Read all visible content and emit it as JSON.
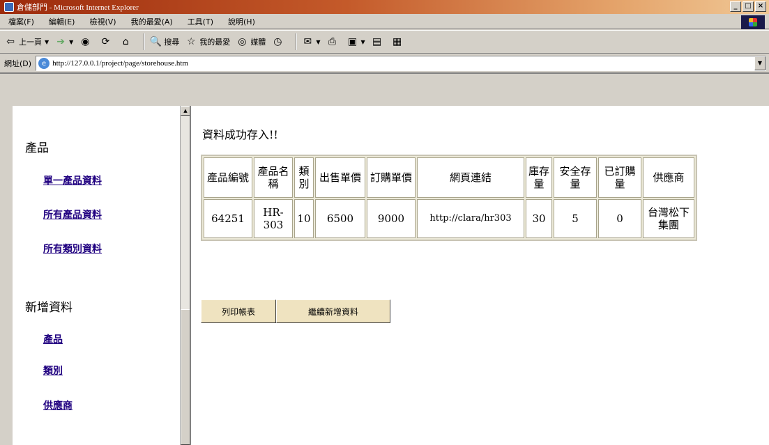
{
  "window": {
    "title": "倉儲部門 - Microsoft Internet Explorer",
    "min": "_",
    "max": "□",
    "close": "×"
  },
  "menu": [
    "檔案(F)",
    "編輯(E)",
    "檢視(V)",
    "我的最愛(A)",
    "工具(T)",
    "說明(H)"
  ],
  "toolbar": {
    "back": "上一頁",
    "search": "搜尋",
    "favorites": "我的最愛",
    "media": "媒體"
  },
  "address": {
    "label": "網址(D)",
    "value": "http://127.0.0.1/project/page/storehouse.htm"
  },
  "nav": {
    "products_title": "產品",
    "product_links": [
      "單一產品資料",
      "所有產品資料",
      "所有類別資料"
    ],
    "add_title": "新增資料",
    "add_links": [
      "產品",
      "類別",
      "供應商"
    ]
  },
  "content": {
    "status": "資料成功存入!!",
    "table": {
      "headers": [
        "產品編號",
        "產品名稱",
        "類別",
        "出售單價",
        "訂購單價",
        "網頁連結",
        "庫存量",
        "安全存量",
        "已訂購量",
        "供應商"
      ],
      "row": [
        "64251",
        "HR-303",
        "10",
        "6500",
        "9000",
        "http://clara/hr303",
        "30",
        "5",
        "0",
        "台灣松下集團"
      ]
    },
    "buttons": {
      "print": "列印帳表",
      "continue": "繼續新增資料"
    }
  },
  "icons": {
    "back": "back-arrow-icon",
    "forward": "forward-arrow-icon",
    "stop": "stop-icon",
    "refresh": "refresh-icon",
    "home": "home-icon"
  }
}
